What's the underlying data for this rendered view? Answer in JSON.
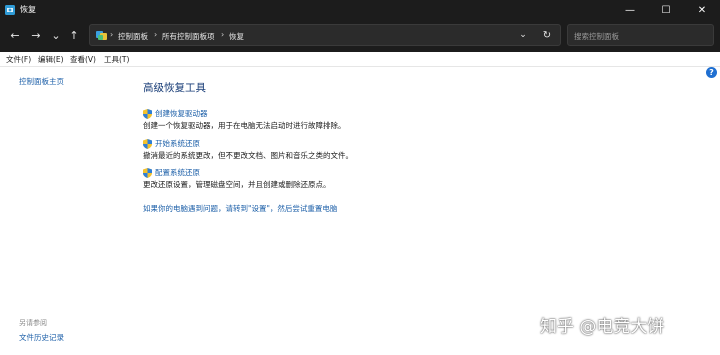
{
  "window": {
    "title": "恢复",
    "minimize": "—",
    "maximize": "☐",
    "close": "✕"
  },
  "nav": {
    "back": "←",
    "forward": "→",
    "history": "⌄",
    "up": "↑",
    "breadcrumb": [
      "控制面板",
      "所有控制面板项",
      "恢复"
    ],
    "separator": "›",
    "dropdown": "⌄",
    "refresh": "↻"
  },
  "search": {
    "placeholder": "搜索控制面板"
  },
  "menu": [
    "文件(F)",
    "编辑(E)",
    "查看(V)",
    "工具(T)"
  ],
  "left_pane": {
    "home": "控制面板主页",
    "see_also": "另请参阅",
    "file_history": "文件历史记录"
  },
  "main": {
    "title": "高级恢复工具",
    "items": [
      {
        "link": "创建恢复驱动器",
        "desc": "创建一个恢复驱动器，用于在电脑无法启动时进行故障排除。"
      },
      {
        "link": "开始系统还原",
        "desc": "撤消最近的系统更改，但不更改文档、图片和音乐之类的文件。"
      },
      {
        "link": "配置系统还原",
        "desc": "更改还原设置，管理磁盘空间，并且创建或删除还原点。"
      }
    ],
    "reset_link": "如果你的电脑遇到问题，请转到\"设置\"，然后尝试重置电脑"
  },
  "help": "?",
  "watermark": "知乎 @电竞大饼",
  "colors": {
    "titlebar": "#1c1c1c",
    "link": "#1c5fa8",
    "heading": "#1a3e78",
    "accent": "#1f6fd1"
  },
  "icons": {
    "title": "recovery-icon",
    "address": "control-panel-icon",
    "items": "shield-icon"
  }
}
